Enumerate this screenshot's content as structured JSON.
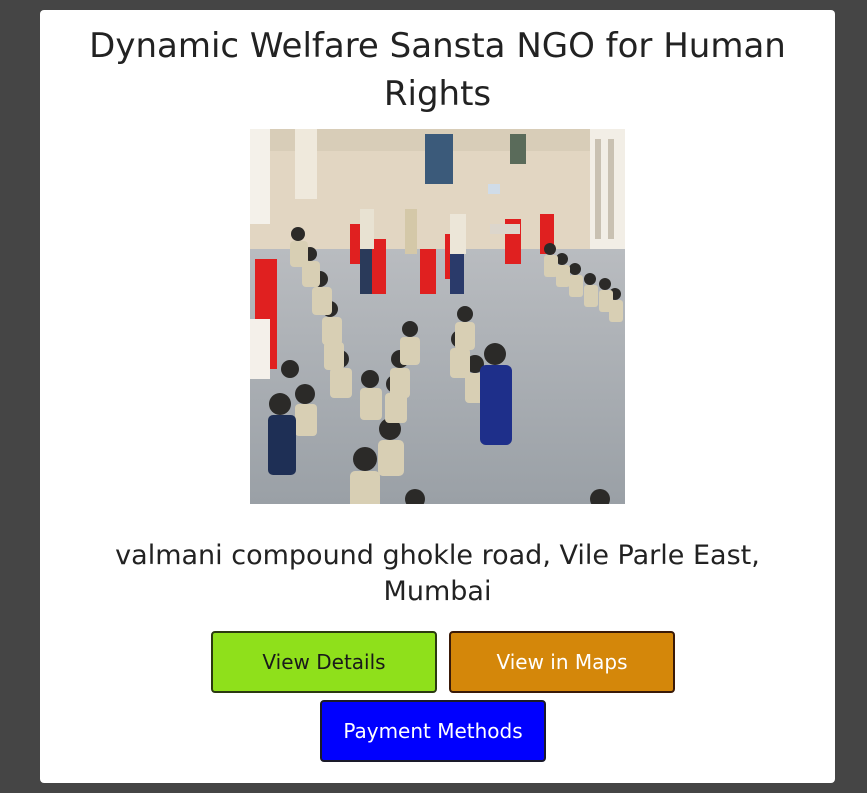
{
  "card": {
    "title": "Dynamic Welfare Sansta NGO for Human Rights",
    "address": "valmani compound ghokle road, Vile Parle East, Mumbai"
  },
  "buttons": {
    "view_details": "View Details",
    "view_in_maps": "View in Maps",
    "payment_methods": "Payment Methods"
  },
  "colors": {
    "page_background": "#454545",
    "card_background": "#ffffff",
    "view_details_bg": "#8fe01b",
    "view_in_maps_bg": "#d4870a",
    "payment_methods_bg": "#0000ff"
  }
}
